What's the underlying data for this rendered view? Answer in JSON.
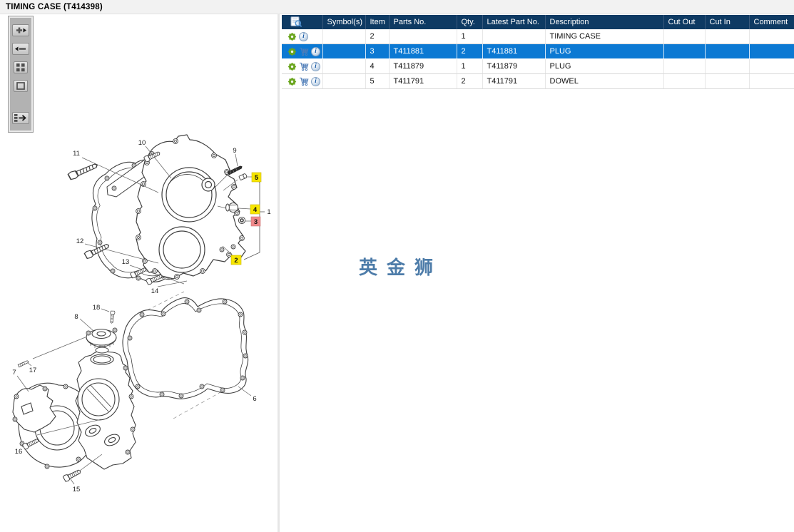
{
  "window": {
    "title": "TIMING CASE (T414398)"
  },
  "toolbar": {
    "buttons": [
      {
        "id": "zoom-in",
        "icon": "zoom-in-icon"
      },
      {
        "id": "zoom-out",
        "icon": "zoom-out-icon"
      },
      {
        "id": "tile-view",
        "icon": "tiles-icon"
      },
      {
        "id": "frame-view",
        "icon": "square-icon"
      },
      {
        "id": "toggle-list",
        "icon": "list-arrow-icon"
      }
    ]
  },
  "diagram": {
    "watermark": "英金狮",
    "watermark_color": "#4d7ca9",
    "highlight_colors": {
      "yellow": "#f7e600",
      "red": "#f0898a"
    },
    "labels": {
      "1": {
        "text": "1",
        "highlight": "none"
      },
      "2": {
        "text": "2",
        "highlight": "yellow"
      },
      "3": {
        "text": "3",
        "highlight": "red"
      },
      "4": {
        "text": "4",
        "highlight": "yellow"
      },
      "5": {
        "text": "5",
        "highlight": "yellow"
      },
      "6": {
        "text": "6",
        "highlight": "none"
      },
      "7": {
        "text": "7",
        "highlight": "none"
      },
      "8": {
        "text": "8",
        "highlight": "none"
      },
      "9": {
        "text": "9",
        "highlight": "none"
      },
      "10": {
        "text": "10",
        "highlight": "none"
      },
      "11": {
        "text": "11",
        "highlight": "none"
      },
      "12": {
        "text": "12",
        "highlight": "none"
      },
      "13": {
        "text": "13",
        "highlight": "none"
      },
      "14": {
        "text": "14",
        "highlight": "none"
      },
      "15": {
        "text": "15",
        "highlight": "none"
      },
      "16": {
        "text": "16",
        "highlight": "none"
      },
      "17": {
        "text": "17",
        "highlight": "none"
      },
      "18": {
        "text": "18",
        "highlight": "none"
      }
    }
  },
  "table": {
    "colors": {
      "header_bg": "#0e3a63",
      "selected_bg": "#0c79d3"
    },
    "header_icon": "picture-search-icon",
    "row_icons": {
      "gear": "settings-gear-icon",
      "cart": "add-to-cart-icon",
      "info": "info-icon"
    },
    "headers": {
      "symbols": "Symbol(s)",
      "item": "Item",
      "parts_no": "Parts No.",
      "qty": "Qty.",
      "latest_part_no": "Latest Part No.",
      "description": "Description",
      "cut_out": "Cut Out",
      "cut_in": "Cut In",
      "comment": "Comment"
    },
    "rows": [
      {
        "symbols": "",
        "item": "2",
        "parts_no": "",
        "qty": "1",
        "latest_part_no": "",
        "description": "TIMING CASE",
        "cut_out": "",
        "cut_in": "",
        "comment": "",
        "selected": false
      },
      {
        "symbols": "",
        "item": "3",
        "parts_no": "T411881",
        "qty": "2",
        "latest_part_no": "T411881",
        "description": "PLUG",
        "cut_out": "",
        "cut_in": "",
        "comment": "",
        "selected": true
      },
      {
        "symbols": "",
        "item": "4",
        "parts_no": "T411879",
        "qty": "1",
        "latest_part_no": "T411879",
        "description": "PLUG",
        "cut_out": "",
        "cut_in": "",
        "comment": "",
        "selected": false
      },
      {
        "symbols": "",
        "item": "5",
        "parts_no": "T411791",
        "qty": "2",
        "latest_part_no": "T411791",
        "description": "DOWEL",
        "cut_out": "",
        "cut_in": "",
        "comment": "",
        "selected": false
      }
    ]
  }
}
